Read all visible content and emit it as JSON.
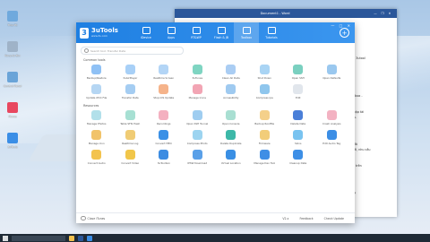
{
  "desktop_icons": [
    {
      "label": "This PC",
      "color": "#6fa9dd"
    },
    {
      "label": "Recycle Bin",
      "color": "#9fb3c8"
    },
    {
      "label": "Control Panel",
      "color": "#6aa4d8"
    },
    {
      "label": "iTunes",
      "color": "#e8475f"
    },
    {
      "label": "3uTools",
      "color": "#3a8ee6"
    }
  ],
  "word_window": {
    "title": "Document1 - Word",
    "controls": [
      "—",
      "❐",
      "✕"
    ],
    "text_lines": [
      "",
      "",
      "qua 3utool",
      "",
      "",
      "",
      "",
      "",
      "",
      "Toolbox -",
      "",
      "",
      "- Nhập tài",
      "kiều.",
      "",
      "",
      "",
      "",
      "số đã",
      "i mới, nhu cầu",
      "",
      "",
      "n lý trên",
      "",
      "",
      "",
      "",
      "máy"
    ]
  },
  "app": {
    "logo": {
      "name": "3uTools",
      "site": "www.3u.com"
    },
    "tabs": [
      {
        "label": "iDevice",
        "icon": "phone-icon",
        "active": false
      },
      {
        "label": "Apps",
        "icon": "apps-icon",
        "active": false
      },
      {
        "label": "RT&WP",
        "icon": "ringtone-icon",
        "active": false
      },
      {
        "label": "Flash & JB",
        "icon": "flash-icon",
        "active": false
      },
      {
        "label": "Toolbox",
        "icon": "toolbox-icon",
        "active": true
      },
      {
        "label": "Tutorials",
        "icon": "tutorials-icon",
        "active": false
      }
    ],
    "window_controls": "— □ ✕",
    "search_placeholder": "Search tool: Transfer Data",
    "sections": [
      {
        "title": "Common tools",
        "tools": [
          {
            "label": "Backup/Restore",
            "color": "#8fc1f5"
          },
          {
            "label": "3uAirPlayer",
            "color": "#a8d0f7"
          },
          {
            "label": "Realtime Screen",
            "color": "#b3d5f6"
          },
          {
            "label": "3uTunes",
            "color": "#7fd5c2"
          },
          {
            "label": "Clean All Data",
            "color": "#aacdf3"
          },
          {
            "label": "Shut Down",
            "color": "#a9d4f4"
          },
          {
            "label": "Open SSH",
            "color": "#7ad0c0"
          },
          {
            "label": "Open Defaults",
            "color": "#9ac8ef"
          },
          {
            "label": "Update iPCC File",
            "color": "#b5d6f3"
          },
          {
            "label": "Transfer Data",
            "color": "#a5cdf2"
          },
          {
            "label": "Stop iOS Update",
            "color": "#f5b38a"
          },
          {
            "label": "Manage Icons",
            "color": "#f2a5b4"
          },
          {
            "label": "Accessibility",
            "color": "#9fcaf0"
          },
          {
            "label": "Compress ipa",
            "color": "#8fc6ed"
          },
          {
            "label": "Edit",
            "color": "#e1e6ec"
          }
        ]
      },
      {
        "title": "Resources",
        "tools": [
          {
            "label": "Manage Photos",
            "color": "#b2e0ea"
          },
          {
            "label": "Table SFSI Hash",
            "color": "#a7e0d3"
          },
          {
            "label": "Recordings",
            "color": "#f4b0c0"
          },
          {
            "label": "Open SSH Tunnel",
            "color": "#9fcdf0"
          },
          {
            "label": "Open Console",
            "color": "#a9dfd2"
          },
          {
            "label": "Backup Rootfile",
            "color": "#f4d08a"
          },
          {
            "label": "Delete Data",
            "color": "#4a7fd8"
          },
          {
            "label": "Crash Analysis",
            "color": "#f3b2c2"
          },
          {
            "label": "Manage Icon",
            "color": "#f1c36a"
          },
          {
            "label": "Realtime Log",
            "color": "#f0cc75"
          },
          {
            "label": "Convert HEIC",
            "color": "#3a90e6"
          },
          {
            "label": "Compress Photo",
            "color": "#9dd4f0"
          },
          {
            "label": "Delete Duplicate",
            "color": "#3db8a8"
          },
          {
            "label": "Firmware",
            "color": "#f2cd79"
          },
          {
            "label": "Skins",
            "color": "#79c3f0"
          },
          {
            "label": "Edit Audio Tag",
            "color": "#3c8ee5"
          },
          {
            "label": "Convert Audio",
            "color": "#f3c34e"
          },
          {
            "label": "Convert Video",
            "color": "#f1c64a"
          },
          {
            "label": "3uToolbox",
            "color": "#3c8ce2"
          },
          {
            "label": "IPSW Download",
            "color": "#5aa0e8"
          },
          {
            "label": "Virtual Location",
            "color": "#3a8fe4"
          },
          {
            "label": "Manage Dev Tool",
            "color": "#3f8ee5"
          },
          {
            "label": "Cleanup Data",
            "color": "#3d8fe6"
          }
        ]
      }
    ],
    "footer": {
      "close_itunes": "Close iTunes",
      "version": "V2.x",
      "feedback": "Feedback",
      "check_update": "Check Update"
    }
  }
}
